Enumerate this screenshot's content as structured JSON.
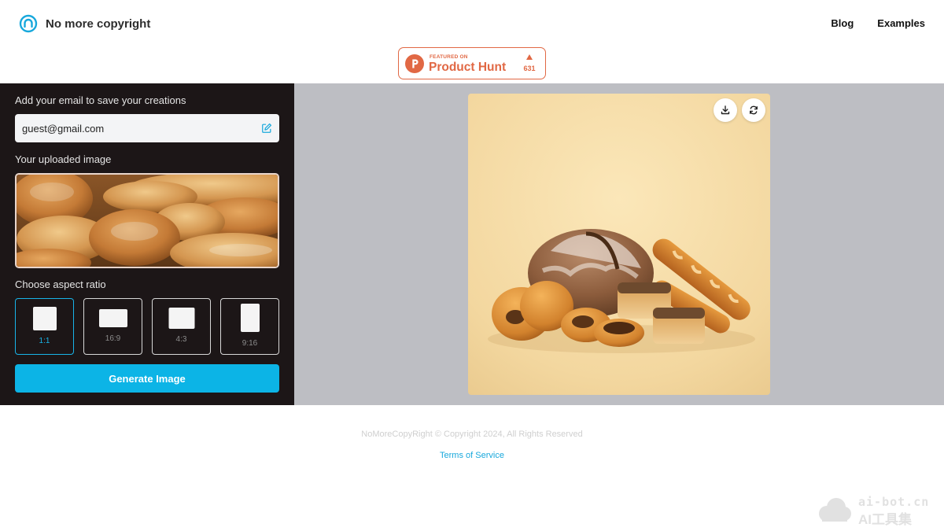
{
  "app": {
    "name": "No more copyright"
  },
  "nav": {
    "blog": "Blog",
    "examples": "Examples"
  },
  "product_hunt": {
    "featured": "FEATURED ON",
    "name": "Product Hunt",
    "count": "631",
    "brand_color": "#e16844"
  },
  "sidebar": {
    "email_label": "Add your email to save your creations",
    "email_value": "guest@gmail.com",
    "uploaded_label": "Your uploaded image",
    "ratio_label": "Choose aspect ratio",
    "ratios": [
      {
        "label": "1:1",
        "selected": true
      },
      {
        "label": "16:9",
        "selected": false
      },
      {
        "label": "4:3",
        "selected": false
      },
      {
        "label": "9:16",
        "selected": false
      }
    ],
    "generate_label": "Generate Image"
  },
  "result": {
    "icons": [
      "download-icon",
      "refresh-icon"
    ]
  },
  "footer": {
    "copyright": "NoMoreCopyRight © Copyright 2024, All Rights Reserved",
    "terms": "Terms of Service"
  },
  "watermark": {
    "line1": "ai-bot.cn",
    "line2": "AI工具集"
  },
  "colors": {
    "accent": "#0cb4e6",
    "sidebar_bg": "#1c1617",
    "stage_bg": "#bdbec3"
  }
}
